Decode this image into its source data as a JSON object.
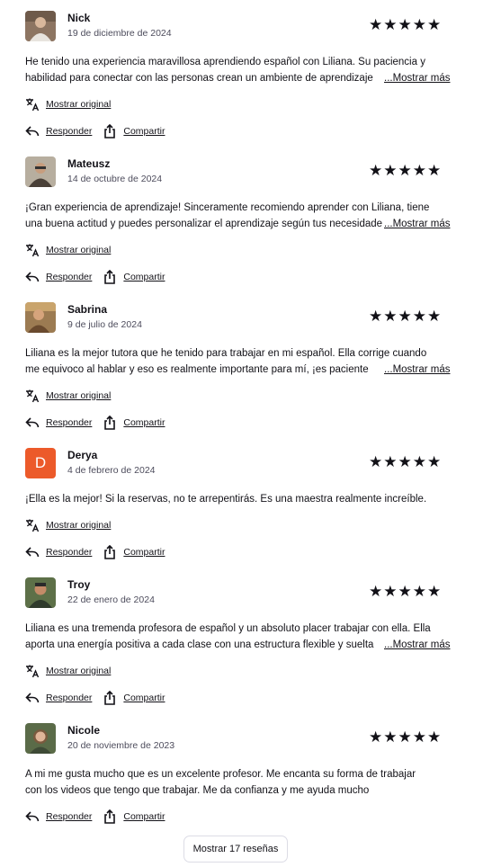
{
  "labels": {
    "show_original": "Mostrar original",
    "reply": "Responder",
    "share": "Compartir",
    "show_more": "...Mostrar más",
    "show_all_reviews": "Mostrar 17 reseñas"
  },
  "reviews": [
    {
      "name": "Nick",
      "date": "19 de diciembre de 2024",
      "rating": 5,
      "stars": "★★★★★",
      "line1": "He tenido una experiencia maravillosa aprendiendo español con Liliana. Su paciencia y",
      "line2": "habilidad para conectar con las personas crean un ambiente de aprendizaje",
      "truncated": true,
      "avatar": "photo"
    },
    {
      "name": "Mateusz",
      "date": "14 de octubre de 2024",
      "rating": 5,
      "stars": "★★★★★",
      "line1": "¡Gran experiencia de aprendizaje! Sinceramente recomiendo aprender con Liliana, tiene",
      "line2": "una buena actitud y puedes personalizar el aprendizaje según tus necesidades",
      "truncated": true,
      "avatar": "photo"
    },
    {
      "name": "Sabrina",
      "date": "9 de julio de 2024",
      "rating": 5,
      "stars": "★★★★★",
      "line1": "Liliana es la mejor tutora que he tenido para trabajar en mi español. Ella corrige cuando",
      "line2": "me equivoco al hablar y eso es realmente importante para mí, ¡es paciente",
      "truncated": true,
      "avatar": "photo"
    },
    {
      "name": "Derya",
      "date": "4 de febrero de 2024",
      "rating": 5,
      "stars": "★★★★★",
      "line1": "¡Ella es la mejor! Si la reservas, no te arrepentirás. Es una maestra realmente increíble.",
      "line2": "",
      "truncated": false,
      "avatar": "initial",
      "initial": "D",
      "avatar_color": "#ec5a2a"
    },
    {
      "name": "Troy",
      "date": "22 de enero de 2024",
      "rating": 5,
      "stars": "★★★★★",
      "line1": "Liliana es una tremenda profesora de español y un absoluto placer trabajar con ella. Ella",
      "line2": "aporta una energía positiva a cada clase con una estructura flexible y suelta",
      "truncated": true,
      "avatar": "photo"
    },
    {
      "name": "Nicole",
      "date": "20 de noviembre de 2023",
      "rating": 5,
      "stars": "★★★★★",
      "line1": "A mi me gusta mucho que es un excelente profesor. Me encanta su forma de trabajar",
      "line2": "con los videos que tengo que trabajar. Me da confianza y me ayuda mucho",
      "truncated": false,
      "has_show_original": false,
      "avatar": "photo"
    }
  ],
  "icons": {
    "translate": "translate-icon",
    "reply": "reply-icon",
    "share": "share-icon",
    "star": "star-icon"
  }
}
